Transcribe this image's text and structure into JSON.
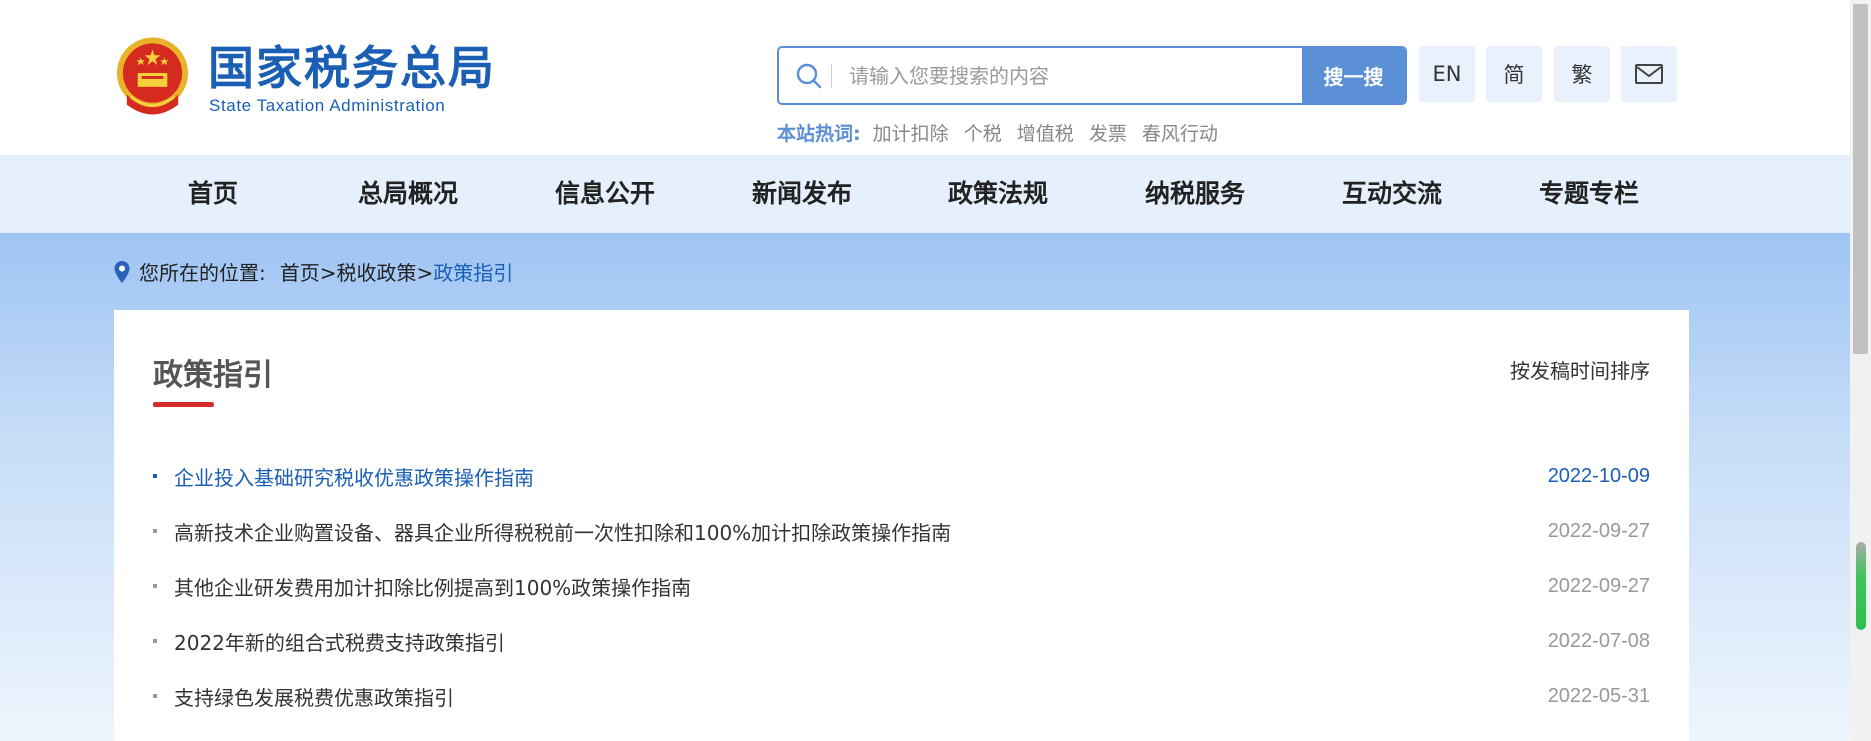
{
  "header": {
    "site_title": "国家税务总局",
    "site_subtitle": "State Taxation Administration",
    "search": {
      "placeholder": "请输入您要搜索的内容",
      "button_label": "搜一搜"
    },
    "lang_buttons": [
      "EN",
      "简",
      "繁"
    ],
    "mail_icon": "mail-icon",
    "hotwords_label": "本站热词:",
    "hotwords": [
      "加计扣除",
      "个税",
      "增值税",
      "发票",
      "春风行动"
    ]
  },
  "nav": {
    "items": [
      "首页",
      "总局概况",
      "信息公开",
      "新闻发布",
      "政策法规",
      "纳税服务",
      "互动交流",
      "专题专栏"
    ]
  },
  "breadcrumb": {
    "icon": "location-pin-icon",
    "prefix": "您所在的位置:",
    "path": "首页>税收政策>",
    "current": "政策指引"
  },
  "content": {
    "title": "政策指引",
    "sort_label": "按发稿时间排序",
    "items": [
      {
        "title": "企业投入基础研究税收优惠政策操作指南",
        "date": "2022-10-09"
      },
      {
        "title": "高新技术企业购置设备、器具企业所得税税前一次性扣除和100%加计扣除政策操作指南",
        "date": "2022-09-27"
      },
      {
        "title": "其他企业研发费用加计扣除比例提高到100%政策操作指南",
        "date": "2022-09-27"
      },
      {
        "title": "2022年新的组合式税费支持政策指引",
        "date": "2022-07-08"
      },
      {
        "title": "支持绿色发展税费优惠政策指引",
        "date": "2022-05-31"
      }
    ]
  },
  "colors": {
    "brand_blue": "#1a5fb4",
    "search_blue": "#5b8fd6",
    "accent_red": "#d52b2b",
    "nav_bg": "#e6f0fc"
  }
}
